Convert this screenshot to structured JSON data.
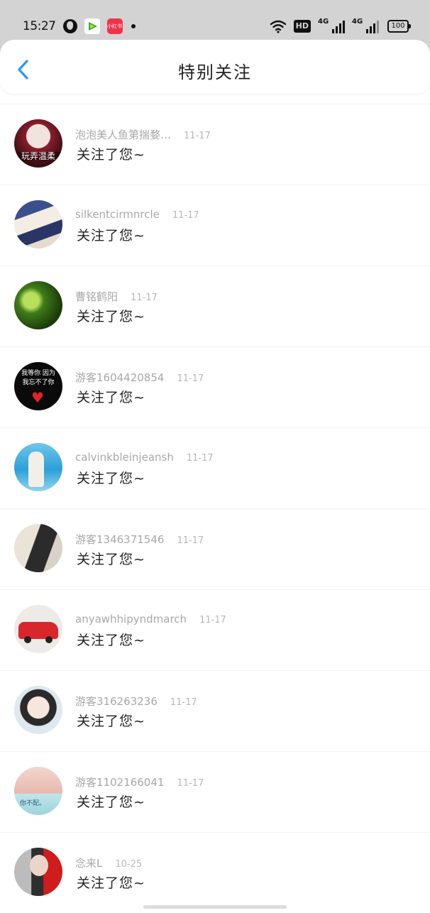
{
  "status_bar": {
    "time": "15:27",
    "app_icon_label": "小红书",
    "hd_label": "HD",
    "network_1": "4G",
    "network_2": "4G",
    "battery": "100"
  },
  "header": {
    "title": "特别关注"
  },
  "icons": {
    "back": "back-chevron-icon",
    "globe": "globe-icon",
    "wifi": "wifi-icon",
    "signal": "signal-icon",
    "battery": "battery-icon"
  },
  "colors": {
    "accent": "#2b95f2",
    "status_bar_bg": "#d3d3d3"
  },
  "items": [
    {
      "username": "泡泡美人鱼第揣婺…",
      "date": "11-17",
      "message": "关注了您~",
      "avatar_text": "玩弄温柔"
    },
    {
      "username": "silkentcirmnrcle",
      "date": "11-17",
      "message": "关注了您~",
      "avatar_text": ""
    },
    {
      "username": "曹铭鹤阳",
      "date": "11-17",
      "message": "关注了您~",
      "avatar_text": ""
    },
    {
      "username": "游客1604420854",
      "date": "11-17",
      "message": "关注了您~",
      "avatar_text": "我等你 因为我忘不了你"
    },
    {
      "username": "calvinkbleinjeansh",
      "date": "11-17",
      "message": "关注了您~",
      "avatar_text": ""
    },
    {
      "username": "游客1346371546",
      "date": "11-17",
      "message": "关注了您~",
      "avatar_text": ""
    },
    {
      "username": "anyawhhipyndmarch",
      "date": "11-17",
      "message": "关注了您~",
      "avatar_text": ""
    },
    {
      "username": "游客316263236",
      "date": "11-17",
      "message": "关注了您~",
      "avatar_text": ""
    },
    {
      "username": "游客1102166041",
      "date": "11-17",
      "message": "关注了您~",
      "avatar_text": "你不配。"
    },
    {
      "username": "念来L",
      "date": "10-25",
      "message": "关注了您~",
      "avatar_text": ""
    }
  ]
}
